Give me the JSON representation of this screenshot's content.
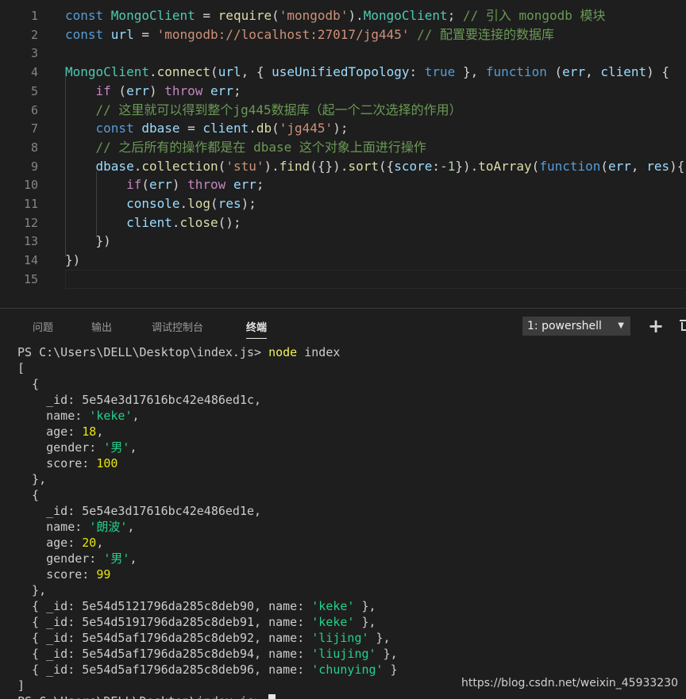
{
  "editor": {
    "lines": [
      {
        "n": "1",
        "tokens": [
          {
            "t": "const ",
            "c": "kw"
          },
          {
            "t": "MongoClient",
            "c": "cls"
          },
          {
            "t": " = ",
            "c": "pl"
          },
          {
            "t": "require",
            "c": "fn"
          },
          {
            "t": "(",
            "c": "pl"
          },
          {
            "t": "'mongodb'",
            "c": "str"
          },
          {
            "t": ").",
            "c": "pl"
          },
          {
            "t": "MongoClient",
            "c": "cls"
          },
          {
            "t": "; ",
            "c": "pl"
          },
          {
            "t": "// 引入 mongodb 模块",
            "c": "com"
          }
        ]
      },
      {
        "n": "2",
        "tokens": [
          {
            "t": "const ",
            "c": "kw"
          },
          {
            "t": "url",
            "c": "var"
          },
          {
            "t": " = ",
            "c": "pl"
          },
          {
            "t": "'mongodb://localhost:27017/jg445'",
            "c": "str"
          },
          {
            "t": " ",
            "c": "pl"
          },
          {
            "t": "// 配置要连接的数据库",
            "c": "com"
          }
        ]
      },
      {
        "n": "3",
        "tokens": []
      },
      {
        "n": "4",
        "tokens": [
          {
            "t": "MongoClient",
            "c": "cls"
          },
          {
            "t": ".",
            "c": "pl"
          },
          {
            "t": "connect",
            "c": "fn"
          },
          {
            "t": "(",
            "c": "pl"
          },
          {
            "t": "url",
            "c": "var"
          },
          {
            "t": ", { ",
            "c": "pl"
          },
          {
            "t": "useUnifiedTopology",
            "c": "var"
          },
          {
            "t": ": ",
            "c": "pl"
          },
          {
            "t": "true",
            "c": "kw"
          },
          {
            "t": " }, ",
            "c": "pl"
          },
          {
            "t": "function",
            "c": "kw"
          },
          {
            "t": " (",
            "c": "pl"
          },
          {
            "t": "err",
            "c": "var"
          },
          {
            "t": ", ",
            "c": "pl"
          },
          {
            "t": "client",
            "c": "var"
          },
          {
            "t": ") {",
            "c": "pl"
          }
        ]
      },
      {
        "n": "5",
        "tokens": [
          {
            "t": "    ",
            "c": "pl"
          },
          {
            "t": "if",
            "c": "ctrl"
          },
          {
            "t": " (",
            "c": "pl"
          },
          {
            "t": "err",
            "c": "var"
          },
          {
            "t": ") ",
            "c": "pl"
          },
          {
            "t": "throw",
            "c": "ctrl"
          },
          {
            "t": " ",
            "c": "pl"
          },
          {
            "t": "err",
            "c": "var"
          },
          {
            "t": ";",
            "c": "pl"
          }
        ]
      },
      {
        "n": "6",
        "tokens": [
          {
            "t": "    ",
            "c": "pl"
          },
          {
            "t": "// 这里就可以得到整个jg445数据库（起一个二次选择的作用）",
            "c": "com"
          }
        ]
      },
      {
        "n": "7",
        "tokens": [
          {
            "t": "    ",
            "c": "pl"
          },
          {
            "t": "const ",
            "c": "kw"
          },
          {
            "t": "dbase",
            "c": "var"
          },
          {
            "t": " = ",
            "c": "pl"
          },
          {
            "t": "client",
            "c": "var"
          },
          {
            "t": ".",
            "c": "pl"
          },
          {
            "t": "db",
            "c": "fn"
          },
          {
            "t": "(",
            "c": "pl"
          },
          {
            "t": "'jg445'",
            "c": "str"
          },
          {
            "t": ");",
            "c": "pl"
          }
        ]
      },
      {
        "n": "8",
        "tokens": [
          {
            "t": "    ",
            "c": "pl"
          },
          {
            "t": "// 之后所有的操作都是在 dbase 这个对象上面进行操作",
            "c": "com"
          }
        ]
      },
      {
        "n": "9",
        "tokens": [
          {
            "t": "    ",
            "c": "pl"
          },
          {
            "t": "dbase",
            "c": "var"
          },
          {
            "t": ".",
            "c": "pl"
          },
          {
            "t": "collection",
            "c": "fn"
          },
          {
            "t": "(",
            "c": "pl"
          },
          {
            "t": "'stu'",
            "c": "str"
          },
          {
            "t": ").",
            "c": "pl"
          },
          {
            "t": "find",
            "c": "fn"
          },
          {
            "t": "({}).",
            "c": "pl"
          },
          {
            "t": "sort",
            "c": "fn"
          },
          {
            "t": "({",
            "c": "pl"
          },
          {
            "t": "score",
            "c": "var"
          },
          {
            "t": ":",
            "c": "pl"
          },
          {
            "t": "-1",
            "c": "num"
          },
          {
            "t": "}).",
            "c": "pl"
          },
          {
            "t": "toArray",
            "c": "fn"
          },
          {
            "t": "(",
            "c": "pl"
          },
          {
            "t": "function",
            "c": "kw"
          },
          {
            "t": "(",
            "c": "pl"
          },
          {
            "t": "err",
            "c": "var"
          },
          {
            "t": ", ",
            "c": "pl"
          },
          {
            "t": "res",
            "c": "var"
          },
          {
            "t": "){",
            "c": "pl"
          }
        ]
      },
      {
        "n": "10",
        "tokens": [
          {
            "t": "        ",
            "c": "pl"
          },
          {
            "t": "if",
            "c": "ctrl"
          },
          {
            "t": "(",
            "c": "pl"
          },
          {
            "t": "err",
            "c": "var"
          },
          {
            "t": ") ",
            "c": "pl"
          },
          {
            "t": "throw",
            "c": "ctrl"
          },
          {
            "t": " ",
            "c": "pl"
          },
          {
            "t": "err",
            "c": "var"
          },
          {
            "t": ";",
            "c": "pl"
          }
        ]
      },
      {
        "n": "11",
        "tokens": [
          {
            "t": "        ",
            "c": "pl"
          },
          {
            "t": "console",
            "c": "var"
          },
          {
            "t": ".",
            "c": "pl"
          },
          {
            "t": "log",
            "c": "fn"
          },
          {
            "t": "(",
            "c": "pl"
          },
          {
            "t": "res",
            "c": "var"
          },
          {
            "t": ");",
            "c": "pl"
          }
        ]
      },
      {
        "n": "12",
        "tokens": [
          {
            "t": "        ",
            "c": "pl"
          },
          {
            "t": "client",
            "c": "var"
          },
          {
            "t": ".",
            "c": "pl"
          },
          {
            "t": "close",
            "c": "fn"
          },
          {
            "t": "();",
            "c": "pl"
          }
        ]
      },
      {
        "n": "13",
        "tokens": [
          {
            "t": "    })",
            "c": "pl"
          }
        ]
      },
      {
        "n": "14",
        "tokens": [
          {
            "t": "})",
            "c": "pl"
          }
        ]
      },
      {
        "n": "15",
        "tokens": []
      }
    ]
  },
  "panel": {
    "tabs": [
      "问题",
      "输出",
      "调试控制台",
      "终端"
    ],
    "active_tab": 3,
    "shell_selected": "1: powershell",
    "plus_icon": "+"
  },
  "terminal": {
    "lines": [
      [
        {
          "t": "PS C:\\Users\\DELL\\Desktop\\index.js> ",
          "c": ""
        },
        {
          "t": "node",
          "c": "t-cmd"
        },
        {
          "t": " index",
          "c": ""
        }
      ],
      [
        {
          "t": "[",
          "c": ""
        }
      ],
      [
        {
          "t": "  {",
          "c": ""
        }
      ],
      [
        {
          "t": "    _id: 5e54e3d17616bc42e486ed1c,",
          "c": ""
        }
      ],
      [
        {
          "t": "    name: ",
          "c": ""
        },
        {
          "t": "'keke'",
          "c": "t-str"
        },
        {
          "t": ",",
          "c": ""
        }
      ],
      [
        {
          "t": "    age: ",
          "c": ""
        },
        {
          "t": "18",
          "c": "t-num"
        },
        {
          "t": ",",
          "c": ""
        }
      ],
      [
        {
          "t": "    gender: ",
          "c": ""
        },
        {
          "t": "'男'",
          "c": "t-str"
        },
        {
          "t": ",",
          "c": ""
        }
      ],
      [
        {
          "t": "    score: ",
          "c": ""
        },
        {
          "t": "100",
          "c": "t-num"
        }
      ],
      [
        {
          "t": "  },",
          "c": ""
        }
      ],
      [
        {
          "t": "  {",
          "c": ""
        }
      ],
      [
        {
          "t": "    _id: 5e54e3d17616bc42e486ed1e,",
          "c": ""
        }
      ],
      [
        {
          "t": "    name: ",
          "c": ""
        },
        {
          "t": "'朗波'",
          "c": "t-str"
        },
        {
          "t": ",",
          "c": ""
        }
      ],
      [
        {
          "t": "    age: ",
          "c": ""
        },
        {
          "t": "20",
          "c": "t-num"
        },
        {
          "t": ",",
          "c": ""
        }
      ],
      [
        {
          "t": "    gender: ",
          "c": ""
        },
        {
          "t": "'男'",
          "c": "t-str"
        },
        {
          "t": ",",
          "c": ""
        }
      ],
      [
        {
          "t": "    score: ",
          "c": ""
        },
        {
          "t": "99",
          "c": "t-num"
        }
      ],
      [
        {
          "t": "  },",
          "c": ""
        }
      ],
      [
        {
          "t": "  { _id: 5e54d5121796da285c8deb90, name: ",
          "c": ""
        },
        {
          "t": "'keke'",
          "c": "t-str"
        },
        {
          "t": " },",
          "c": ""
        }
      ],
      [
        {
          "t": "  { _id: 5e54d5191796da285c8deb91, name: ",
          "c": ""
        },
        {
          "t": "'keke'",
          "c": "t-str"
        },
        {
          "t": " },",
          "c": ""
        }
      ],
      [
        {
          "t": "  { _id: 5e54d5af1796da285c8deb92, name: ",
          "c": ""
        },
        {
          "t": "'lijing'",
          "c": "t-str"
        },
        {
          "t": " },",
          "c": ""
        }
      ],
      [
        {
          "t": "  { _id: 5e54d5af1796da285c8deb94, name: ",
          "c": ""
        },
        {
          "t": "'liujing'",
          "c": "t-str"
        },
        {
          "t": " },",
          "c": ""
        }
      ],
      [
        {
          "t": "  { _id: 5e54d5af1796da285c8deb96, name: ",
          "c": ""
        },
        {
          "t": "'chunying'",
          "c": "t-str"
        },
        {
          "t": " }",
          "c": ""
        }
      ],
      [
        {
          "t": "]",
          "c": ""
        }
      ],
      [
        {
          "t": "PS C:\\Users\\DELL\\Desktop\\index.js> ",
          "c": ""
        }
      ]
    ]
  },
  "watermark": "https://blog.csdn.net/weixin_45933230"
}
